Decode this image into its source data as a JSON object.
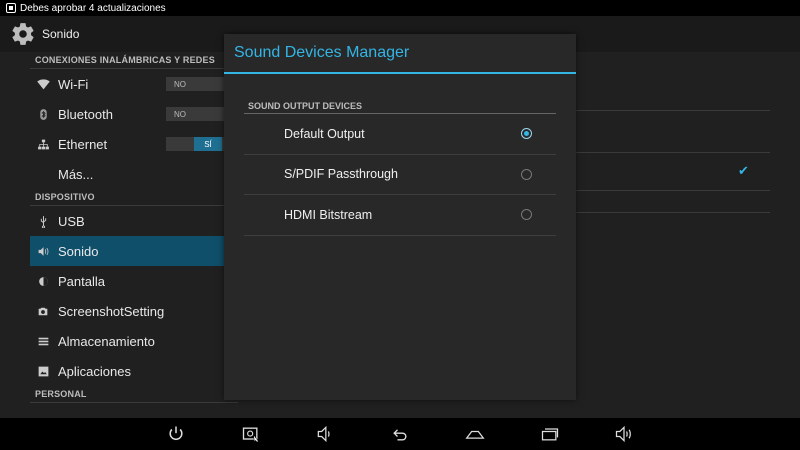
{
  "statusbar": {
    "notification": "Debes aprobar 4 actualizaciones"
  },
  "actionbar": {
    "title": "Sonido",
    "icon": "gear-icon"
  },
  "sidebar": {
    "sections": [
      {
        "label": "CONEXIONES INALÁMBRICAS Y REDES"
      },
      {
        "label": "DISPOSITIVO"
      },
      {
        "label": "PERSONAL"
      }
    ],
    "items": [
      {
        "label": "Wi-Fi",
        "icon": "wifi-icon",
        "toggle": "NO"
      },
      {
        "label": "Bluetooth",
        "icon": "bluetooth-icon",
        "toggle": "NO"
      },
      {
        "label": "Ethernet",
        "icon": "ethernet-icon",
        "toggle": "SÍ"
      },
      {
        "label": "Más...",
        "icon": ""
      },
      {
        "label": "USB",
        "icon": "usb-icon"
      },
      {
        "label": "Sonido",
        "icon": "volume-icon",
        "selected": true
      },
      {
        "label": "Pantalla",
        "icon": "brightness-icon"
      },
      {
        "label": "ScreenshotSetting",
        "icon": "camera-icon"
      },
      {
        "label": "Almacenamiento",
        "icon": "storage-icon"
      },
      {
        "label": "Aplicaciones",
        "icon": "apps-icon"
      }
    ]
  },
  "dialog": {
    "title": "Sound Devices Manager",
    "section": "SOUND OUTPUT DEVICES",
    "options": [
      {
        "label": "Default Output",
        "checked": true
      },
      {
        "label": "S/PDIF Passthrough",
        "checked": false
      },
      {
        "label": "HDMI Bitstream",
        "checked": false
      }
    ]
  },
  "navbar": {
    "icons": [
      "power-icon",
      "screenshot-icon",
      "volume-down-icon",
      "back-icon",
      "home-icon",
      "recents-icon",
      "volume-up-icon"
    ]
  },
  "colors": {
    "accent": "#33b5e5",
    "selected_bg": "#0f4f6a"
  }
}
